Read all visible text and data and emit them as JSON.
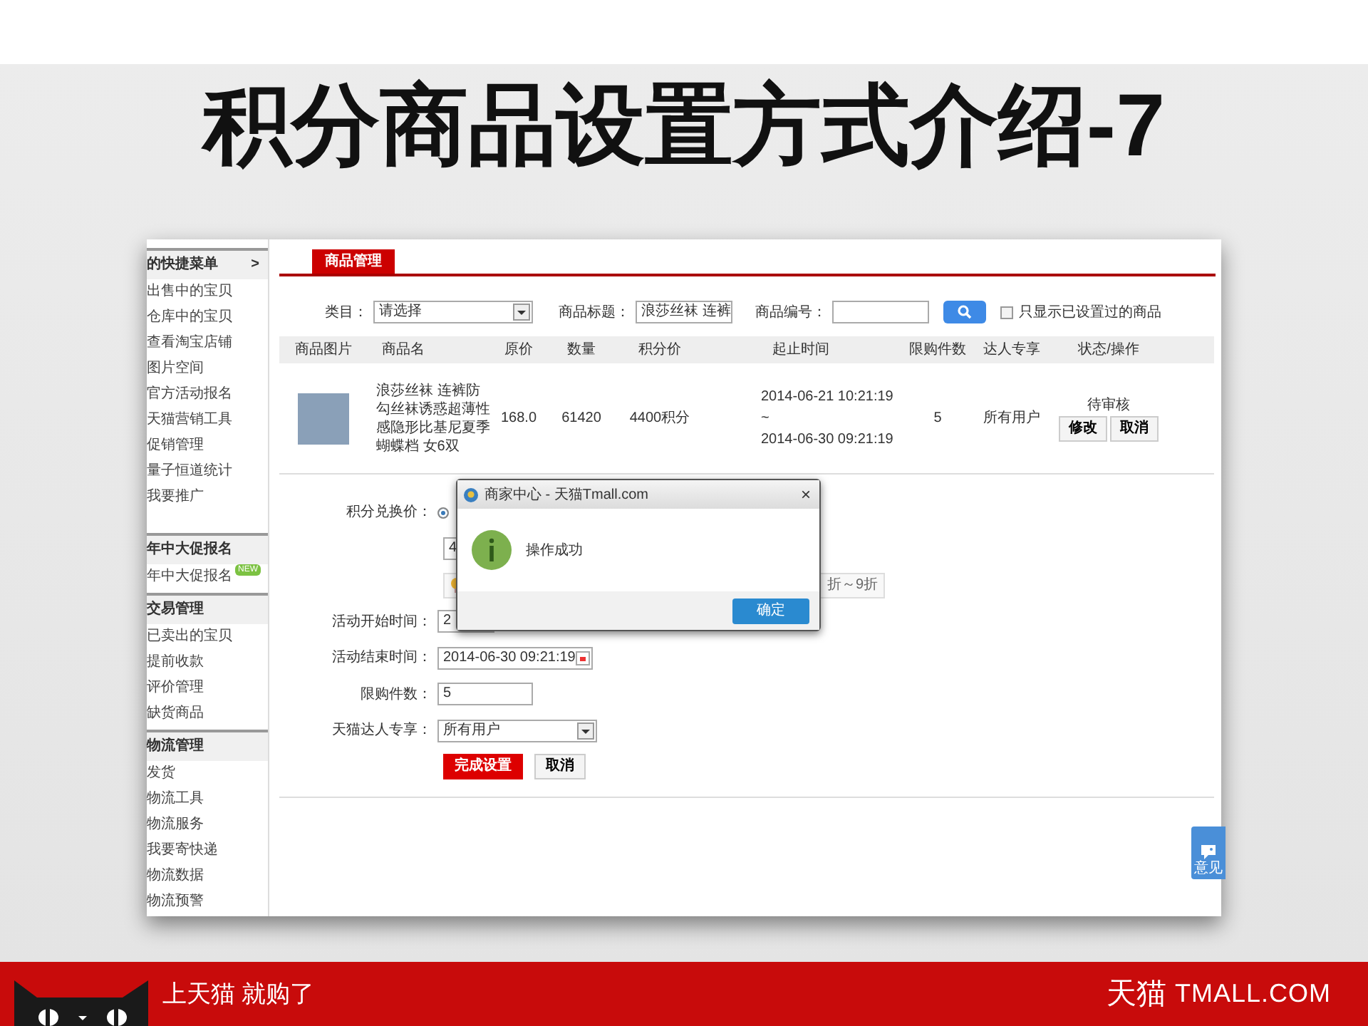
{
  "slide": {
    "title": "积分商品设置方式介绍-7"
  },
  "sidebar": {
    "sections": [
      {
        "title": "的快捷菜单",
        "arrow": ">",
        "items": [
          {
            "label": "出售中的宝贝"
          },
          {
            "label": "仓库中的宝贝"
          },
          {
            "label": "查看淘宝店铺"
          },
          {
            "label": "图片空间"
          },
          {
            "label": "官方活动报名"
          },
          {
            "label": "天猫营销工具"
          },
          {
            "label": "促销管理"
          },
          {
            "label": "量子恒道统计"
          },
          {
            "label": "我要推广"
          }
        ]
      },
      {
        "title": "年中大促报名",
        "items": [
          {
            "label": "年中大促报名",
            "badge": "NEW"
          }
        ]
      },
      {
        "title": "交易管理",
        "items": [
          {
            "label": "已卖出的宝贝"
          },
          {
            "label": "提前收款"
          },
          {
            "label": "评价管理"
          },
          {
            "label": "缺货商品"
          }
        ]
      },
      {
        "title": "物流管理",
        "items": [
          {
            "label": "发货"
          },
          {
            "label": "物流工具"
          },
          {
            "label": "物流服务"
          },
          {
            "label": "我要寄快递"
          },
          {
            "label": "物流数据"
          },
          {
            "label": "物流预警"
          }
        ]
      }
    ]
  },
  "tabs": [
    {
      "label": "商品管理",
      "selected": true
    }
  ],
  "filters": {
    "category_label": "类目：",
    "category_value": "请选择",
    "title_label": "商品标题：",
    "title_value": "浪莎丝袜 连裤",
    "number_label": "商品编号：",
    "only_set_label": "只显示已设置过的商品",
    "only_set_checked": false
  },
  "table": {
    "columns": [
      "商品图片",
      "商品名",
      "原价",
      "数量",
      "积分价",
      "起止时间",
      "限购件数",
      "达人专享",
      "状态/操作"
    ],
    "rows": [
      {
        "name": "浪莎丝袜 连裤防勾丝袜诱惑超薄性感隐形比基尼夏季蝴蝶档 女6双",
        "price": "168.0",
        "quantity": "61420",
        "points": "4400积分",
        "start": "2014-06-21 10:21:19",
        "separator": "~",
        "end": "2014-06-30 09:21:19",
        "limit": "5",
        "vip": "所有用户",
        "status": "待审核",
        "actions": [
          "修改",
          "取消"
        ]
      }
    ]
  },
  "form": {
    "points": {
      "label": "积分兑换价：",
      "checked": true,
      "value": "4",
      "tip": "折～9折"
    },
    "start_time": {
      "label": "活动开始时间：",
      "value": "2"
    },
    "end_time": {
      "label": "活动结束时间：",
      "value": "2014-06-30 09:21:19"
    },
    "limit": {
      "label": "限购件数：",
      "value": "5"
    },
    "vip": {
      "label": "天猫达人专享：",
      "value": "所有用户"
    },
    "buttons": [
      {
        "label": "完成设置",
        "kind": "primary"
      },
      {
        "label": "取消",
        "kind": "default"
      }
    ]
  },
  "dialog": {
    "title": "商家中心 - 天猫Tmall.com",
    "close": "×",
    "message": "操作成功",
    "button": "确定"
  },
  "feedback_tab": {
    "label": "意见"
  },
  "footer": {
    "slogan": "上天猫 就购了",
    "brand": "天猫",
    "domain": "TMALL.COM"
  }
}
